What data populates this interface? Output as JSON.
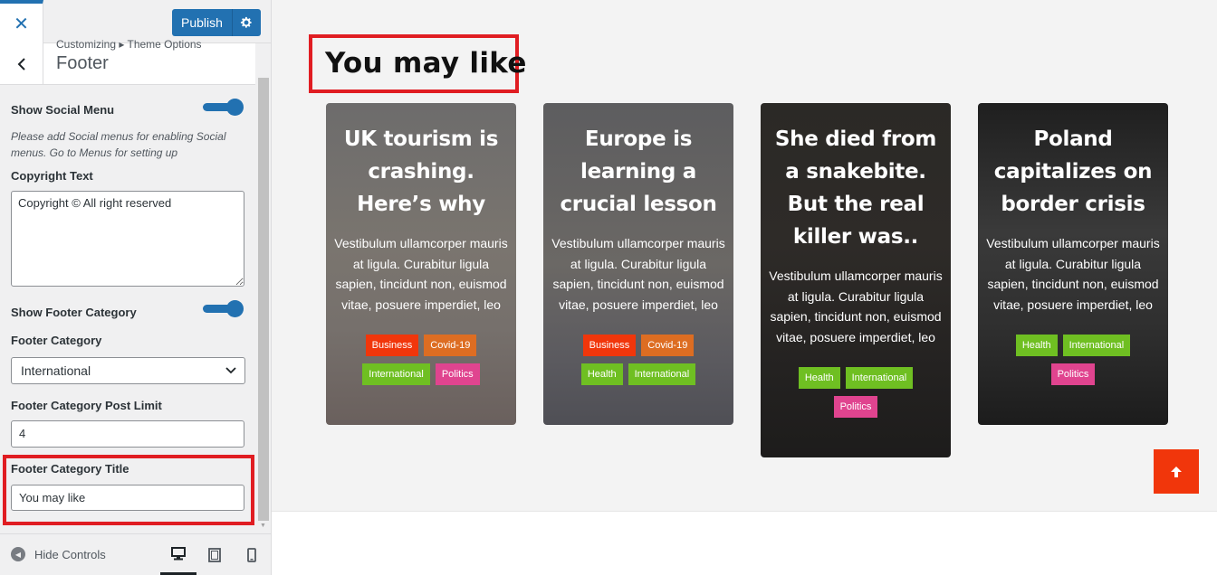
{
  "customizer": {
    "close_icon": "close-icon",
    "publish_label": "Publish",
    "breadcrumb": "Customizing ▸ Theme Options",
    "panel_title": "Footer",
    "controls": {
      "social_menu_label": "Show Social Menu",
      "social_menu_on": true,
      "social_menu_desc": "Please add Social menus for enabling Social menus. Go to Menus for setting up",
      "copyright_label": "Copyright Text",
      "copyright_value": "Copyright © All right reserved",
      "footer_category_toggle_label": "Show Footer Category",
      "footer_category_toggle_on": true,
      "footer_category_label": "Footer Category",
      "footer_category_value": "International",
      "post_limit_label": "Footer Category Post Limit",
      "post_limit_value": "4",
      "category_title_label": "Footer Category Title",
      "category_title_value": "You may like"
    },
    "footer": {
      "hide_controls_label": "Hide Controls"
    },
    "accent_color": "#2271b1",
    "highlight_color": "#e01d22"
  },
  "preview": {
    "section_title": "You may like",
    "cards": [
      {
        "title": "UK tourism is crashing. Here’s why",
        "excerpt": "Vestibulum ullamcorper mauris at ligula. Curabitur ligula sapien, tincidunt non, euismod vitae, posuere imperdiet, leo",
        "tags": [
          "Business",
          "Covid-19",
          "International",
          "Politics"
        ]
      },
      {
        "title": "Europe is learning a crucial lesson",
        "excerpt": "Vestibulum ullamcorper mauris at ligula. Curabitur ligula sapien, tincidunt non, euismod vitae, posuere imperdiet, leo",
        "tags": [
          "Business",
          "Covid-19",
          "Health",
          "International"
        ]
      },
      {
        "title": "She died from a snakebite. But the real killer was..",
        "excerpt": "Vestibulum ullamcorper mauris at ligula. Curabitur ligula sapien, tincidunt non, euismod vitae, posuere imperdiet, leo",
        "tags": [
          "Health",
          "International",
          "Politics"
        ]
      },
      {
        "title": "Poland capitalizes on border crisis",
        "excerpt": "Vestibulum ullamcorper mauris at ligula. Curabitur ligula sapien, tincidunt non, euismod vitae, posuere imperdiet, leo",
        "tags": [
          "Health",
          "International",
          "Politics"
        ]
      }
    ],
    "tag_colors": {
      "Business": "#f1360b",
      "Covid-19": "#dd6d22",
      "Health": "#6fbf22",
      "International": "#6fbf22",
      "Politics": "#e0448f"
    },
    "scroll_top_icon": "arrow-up-icon"
  }
}
